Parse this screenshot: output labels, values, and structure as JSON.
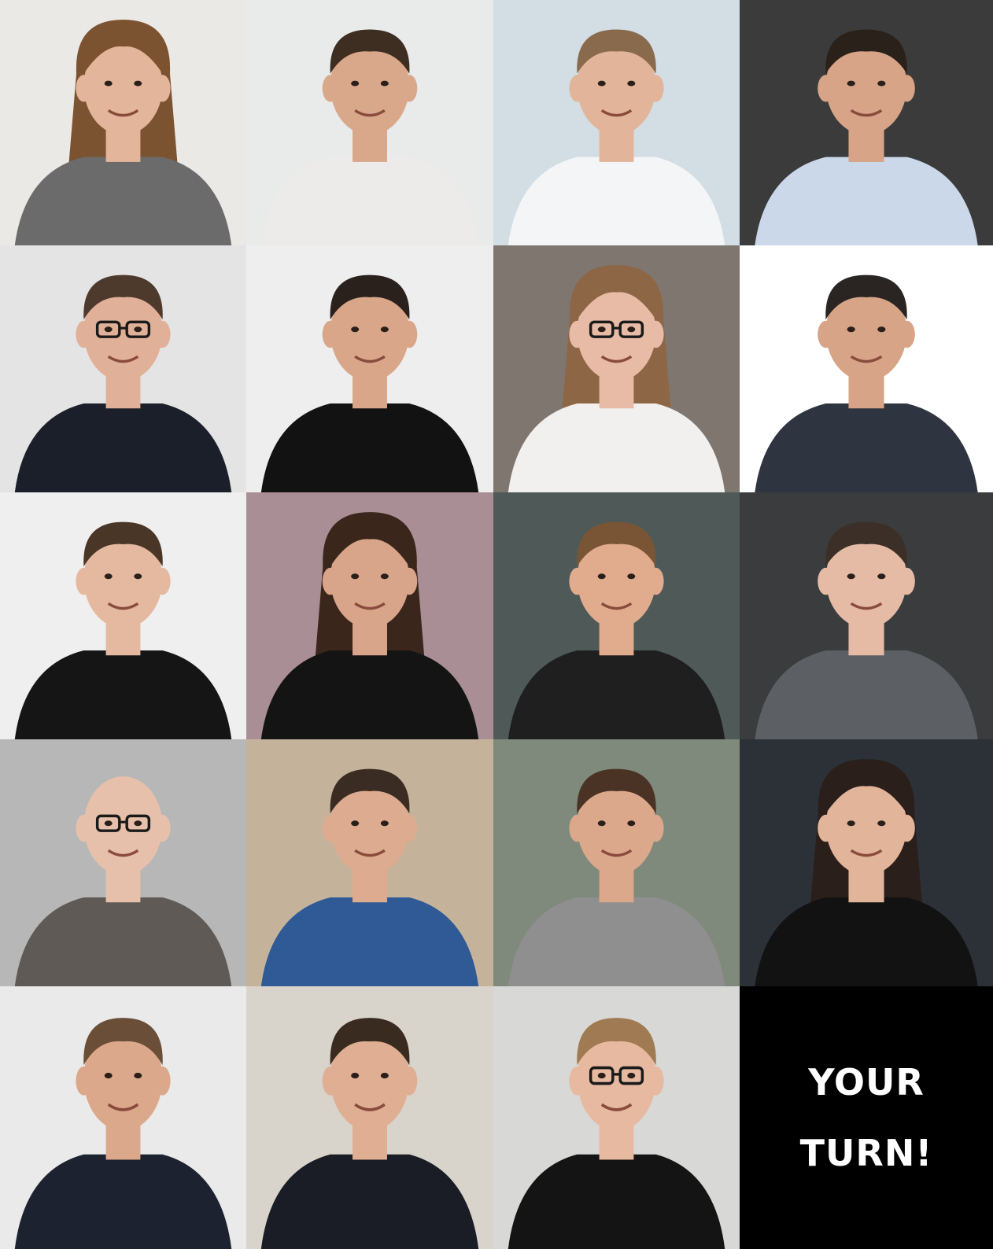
{
  "cta": {
    "line1": "YOUR",
    "line2": "TURN!"
  },
  "portraits": [
    {
      "bg": "#ebe9e6",
      "skin": "#e3b59a",
      "hair": "#7b5331",
      "top": "#6b6b6b",
      "hairstyle": "long",
      "glasses": false
    },
    {
      "bg": "#e9eaea",
      "skin": "#d9a88b",
      "hair": "#3e2d21",
      "top": "#ecebea",
      "hairstyle": "short",
      "glasses": false
    },
    {
      "bg": "#d3dde4",
      "skin": "#e2b59a",
      "hair": "#8a6a4c",
      "top": "#f4f5f7",
      "hairstyle": "short",
      "glasses": false
    },
    {
      "bg": "#3b3b3b",
      "skin": "#d7a487",
      "hair": "#2a211b",
      "top": "#cbd8ea",
      "hairstyle": "short",
      "glasses": false
    },
    {
      "bg": "#e4e4e4",
      "skin": "#e1b098",
      "hair": "#4e3a2c",
      "top": "#1b1f2a",
      "hairstyle": "short",
      "glasses": true
    },
    {
      "bg": "#eeeeee",
      "skin": "#d9a68a",
      "hair": "#2a211c",
      "top": "#121212",
      "hairstyle": "short",
      "glasses": false
    },
    {
      "bg": "#7f7670",
      "skin": "#e7bba5",
      "hair": "#8c6645",
      "top": "#f2f0ef",
      "hairstyle": "long",
      "glasses": true
    },
    {
      "bg": "#ffffff",
      "skin": "#d8a487",
      "hair": "#2a2522",
      "top": "#2e3440",
      "hairstyle": "short",
      "glasses": false
    },
    {
      "bg": "#efefef",
      "skin": "#e4b9a0",
      "hair": "#4a3627",
      "top": "#151515",
      "hairstyle": "short",
      "glasses": false
    },
    {
      "bg": "#a98f95",
      "skin": "#d8a48a",
      "hair": "#3a261b",
      "top": "#141414",
      "hairstyle": "long",
      "glasses": false
    },
    {
      "bg": "#4f5a58",
      "skin": "#e1ac8e",
      "hair": "#7a5535",
      "top": "#1f1f1f",
      "hairstyle": "short",
      "glasses": false
    },
    {
      "bg": "#3a3c3e",
      "skin": "#e5bba6",
      "hair": "#3c2f27",
      "top": "#5c5f63",
      "hairstyle": "short",
      "glasses": false
    },
    {
      "bg": "#b6b7b6",
      "skin": "#e7c0ac",
      "hair": "#e2c7b8",
      "top": "#5f5a56",
      "hairstyle": "bald",
      "glasses": true
    },
    {
      "bg": "#c4b39a",
      "skin": "#dcab90",
      "hair": "#3a2c22",
      "top": "#2f5a95",
      "hairstyle": "short",
      "glasses": false
    },
    {
      "bg": "#7f8a7c",
      "skin": "#dba88c",
      "hair": "#4a3324",
      "top": "#8f8f8f",
      "hairstyle": "short",
      "glasses": false
    },
    {
      "bg": "#2c3138",
      "skin": "#e2b49a",
      "hair": "#2a1f1a",
      "top": "#121212",
      "hairstyle": "long",
      "glasses": false
    },
    {
      "bg": "#eaeaea",
      "skin": "#dca88c",
      "hair": "#6a4e38",
      "top": "#1c2230",
      "hairstyle": "short",
      "glasses": false
    },
    {
      "bg": "#d9d4cb",
      "skin": "#dfae93",
      "hair": "#3a2b20",
      "top": "#1a1d26",
      "hairstyle": "short",
      "glasses": false
    },
    {
      "bg": "#d8d9d6",
      "skin": "#e6b9a0",
      "hair": "#a07a52",
      "top": "#141414",
      "hairstyle": "short",
      "glasses": true
    }
  ]
}
